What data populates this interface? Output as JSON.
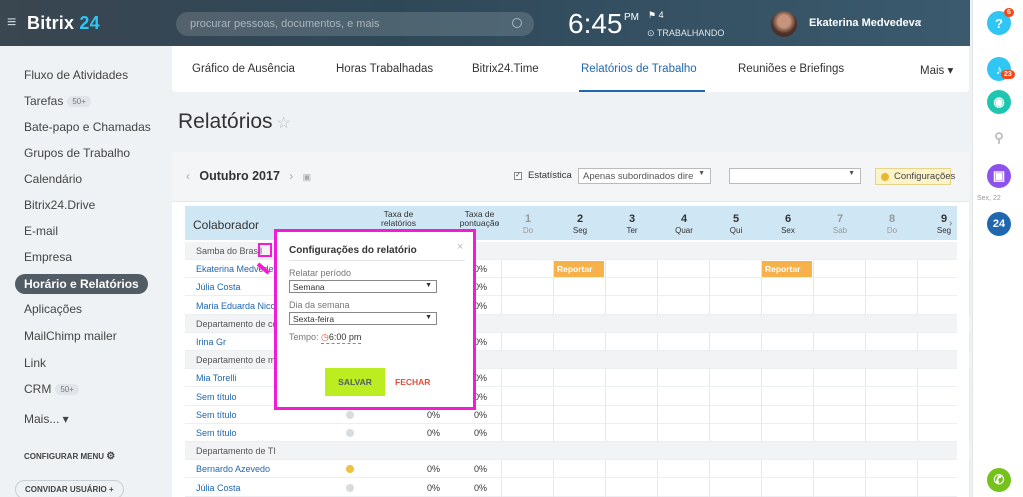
{
  "header": {
    "logo_a": "Bitrix",
    "logo_b": " 24",
    "search_placeholder": "procurar pessoas, documentos, e mais",
    "time": "6:45",
    "ampm": "PM",
    "flag_count": "4",
    "work_status": "TRABALHANDO",
    "user_name": "Ekaterina Medvedeva"
  },
  "sidebar": {
    "items": [
      {
        "label": "Fluxo de Atividades"
      },
      {
        "label": "Tarefas",
        "count": "50+"
      },
      {
        "label": "Bate-papo e Chamadas"
      },
      {
        "label": "Grupos de Trabalho"
      },
      {
        "label": "Calendário"
      },
      {
        "label": "Bitrix24.Drive"
      },
      {
        "label": "E-mail"
      },
      {
        "label": "Empresa"
      },
      {
        "label": "Horário e Relatórios"
      },
      {
        "label": "Aplicações"
      },
      {
        "label": "MailChimp mailer"
      },
      {
        "label": "Link"
      },
      {
        "label": "CRM",
        "count": "50+"
      },
      {
        "label": "Mais... ▾"
      }
    ],
    "configure_menu": "CONFIGURAR MENU",
    "invite_user": "CONVIDAR USUÁRIO"
  },
  "tabs": [
    "Gráfico de Ausência",
    "Horas Trabalhadas",
    "Bitrix24.Time",
    "Relatórios de Trabalho",
    "Reuniões e Briefings",
    "Mais ▾"
  ],
  "page_title": "Relatórios",
  "toolbar": {
    "month": "Outubro 2017",
    "statistics_label": "Estatística",
    "filter_value": "Apenas subordinados dire",
    "settings_label": "Configurações"
  },
  "table": {
    "col_name": "Colaborador",
    "col_rate1": "Taxa de relatórios",
    "col_rate2": "Taxa de pontuação",
    "days": [
      {
        "n": "1",
        "d": "Do",
        "weekend": true
      },
      {
        "n": "2",
        "d": "Seg"
      },
      {
        "n": "3",
        "d": "Ter"
      },
      {
        "n": "4",
        "d": "Quar"
      },
      {
        "n": "5",
        "d": "Qui"
      },
      {
        "n": "6",
        "d": "Sex"
      },
      {
        "n": "7",
        "d": "Sab",
        "weekend": true
      },
      {
        "n": "8",
        "d": "Do",
        "weekend": true
      },
      {
        "n": "9",
        "d": "Seg"
      }
    ],
    "report_label": "Reportar",
    "rows": [
      {
        "name": "Samba do Brasil",
        "group": true
      },
      {
        "name": "Ekaterina Medvedeva",
        "p1": "",
        "p2": "0%"
      },
      {
        "name": "Júlia Costa",
        "p1": "",
        "p2": "0%"
      },
      {
        "name": "Maria Eduarda Nico",
        "p1": "",
        "p2": "0%"
      },
      {
        "name": "Departamento de co",
        "group": true
      },
      {
        "name": "Irina Gr",
        "p1": "",
        "p2": "0%"
      },
      {
        "name": "Departamento de ma",
        "group": true
      },
      {
        "name": "Mia Torelli",
        "p1": "",
        "p2": "0%"
      },
      {
        "name": "Sem título",
        "p1": "",
        "p2": "0%"
      },
      {
        "name": "Sem título",
        "p1": "0%",
        "p2": "0%"
      },
      {
        "name": "Sem título",
        "p1": "0%",
        "p2": "0%"
      },
      {
        "name": "Departamento de TI",
        "group": true
      },
      {
        "name": "Bernardo Azevedo",
        "p1": "0%",
        "p2": "0%"
      },
      {
        "name": "Júlia Costa",
        "p1": "0%",
        "p2": "0%"
      }
    ]
  },
  "popup": {
    "title": "Configurações do relatório",
    "period_label": "Relatar período",
    "period_value": "Semana",
    "weekday_label": "Dia da semana",
    "weekday_value": "Sexta-feira",
    "time_label": "Tempo:",
    "time_value": "6:00 pm",
    "save": "SALVAR",
    "close": "FECHAR"
  },
  "rightbar": {
    "help_badge": "6",
    "notif_badge": "23",
    "date": "Sex, 22",
    "b24": "24"
  }
}
